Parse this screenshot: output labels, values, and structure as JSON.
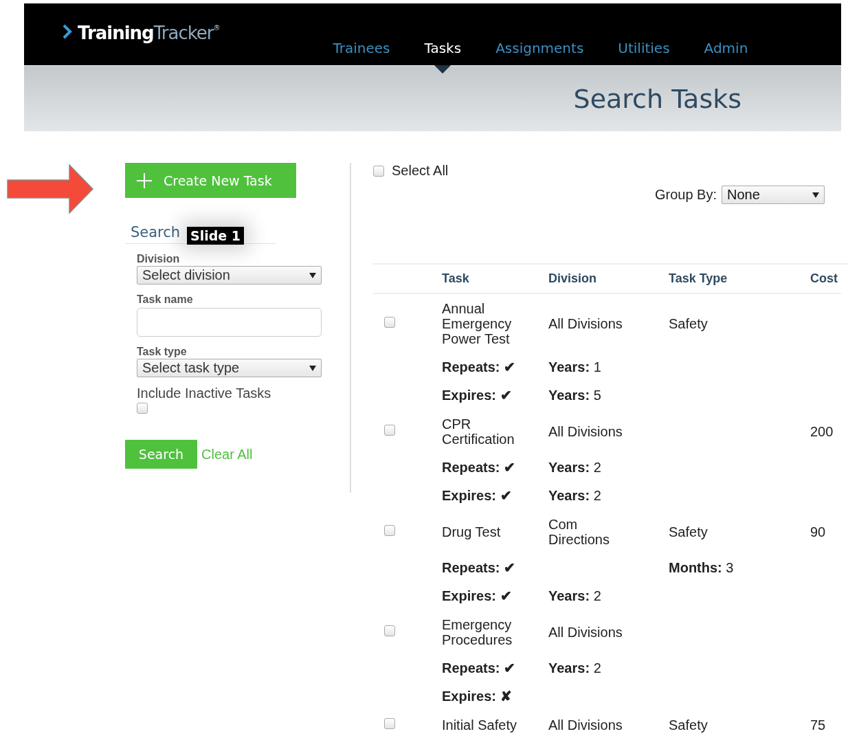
{
  "header": {
    "logo": {
      "first": "Training",
      "second": "Tracker",
      "mark": "®"
    },
    "nav": [
      {
        "label": "Trainees",
        "selected": false
      },
      {
        "label": "Tasks",
        "selected": true
      },
      {
        "label": "Assignments",
        "selected": false
      },
      {
        "label": "Utilities",
        "selected": false
      },
      {
        "label": "Admin",
        "selected": false
      }
    ],
    "page_title": "Search Tasks"
  },
  "sidebar": {
    "create_button": "Create New Task",
    "search_heading": "Search",
    "tooltip": "Slide 1",
    "fields": [
      {
        "kind": "select",
        "label": "Division",
        "value": "Select division"
      },
      {
        "kind": "text",
        "label": "Task name"
      },
      {
        "kind": "select",
        "label": "Task type",
        "value": "Select task type"
      },
      {
        "kind": "checkbox",
        "label": "Include Inactive Tasks",
        "checked": false
      }
    ],
    "search_button": "Search",
    "clear_link": "Clear All"
  },
  "results": {
    "select_all": {
      "label": "Select All",
      "checked": false
    },
    "group_by": {
      "label": "Group By:",
      "value": "None"
    },
    "table": {
      "columns": [
        "Task",
        "Division",
        "Task Type",
        "Cost"
      ],
      "rows": [
        {
          "checked": false,
          "task": "Annual Emergency Power Test",
          "division": "All Divisions",
          "type": "Safety",
          "details": [
            {
              "label": "Repeats:",
              "mark": "✔",
              "division_interval": {
                "unit": "Years:",
                "value": "1"
              }
            },
            {
              "label": "Expires:",
              "mark": "✔",
              "division_interval": {
                "unit": "Years:",
                "value": "5"
              }
            }
          ]
        },
        {
          "checked": false,
          "task": "CPR Certification",
          "division": "All Divisions",
          "cost": "200",
          "details": [
            {
              "label": "Repeats:",
              "mark": "✔",
              "division_interval": {
                "unit": "Years:",
                "value": "2"
              }
            },
            {
              "label": "Expires:",
              "mark": "✔",
              "division_interval": {
                "unit": "Years:",
                "value": "2"
              }
            }
          ]
        },
        {
          "checked": false,
          "task": "Drug Test",
          "division": "Com Directions",
          "type": "Safety",
          "cost": "90",
          "details": [
            {
              "label": "Repeats:",
              "mark": "✔",
              "type_interval": {
                "unit": "Months:",
                "value": "3"
              }
            },
            {
              "label": "Expires:",
              "mark": "✔",
              "division_interval": {
                "unit": "Years:",
                "value": "2"
              }
            }
          ]
        },
        {
          "checked": false,
          "task": "Emergency Procedures",
          "division": "All Divisions",
          "details": [
            {
              "label": "Repeats:",
              "mark": "✔",
              "division_interval": {
                "unit": "Years:",
                "value": "2"
              }
            },
            {
              "label": "Expires:",
              "mark": "✘"
            }
          ]
        },
        {
          "checked": false,
          "task": "Initial Safety",
          "division": "All Divisions",
          "type": "Safety",
          "cost": "75"
        }
      ]
    }
  }
}
